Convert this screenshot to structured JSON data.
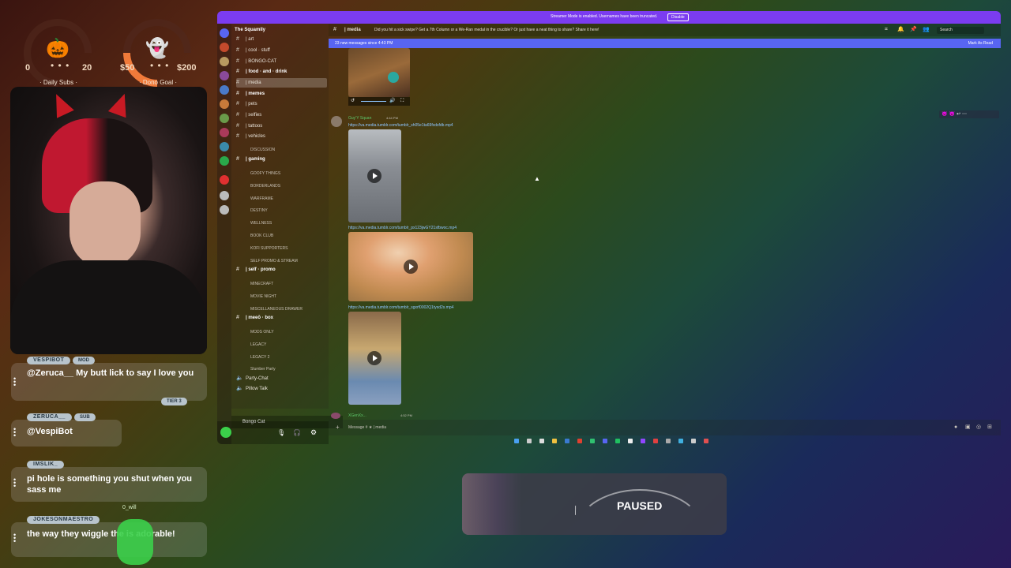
{
  "goals": {
    "subs": {
      "min": "0",
      "dots": "• • •",
      "max": "20",
      "title": "· Daily Subs ·",
      "icon": "🎃",
      "progress": 0.0
    },
    "dono": {
      "min": "$50",
      "dots": "• • •",
      "max": "$200",
      "title": "· Dono Goal ·",
      "icon": "👻",
      "progress": 0.1
    }
  },
  "chat": [
    {
      "user": "VESPIBOT",
      "badge": "MOD",
      "text": "@Zeruca__ My butt lick to say I love you",
      "tier": "TIER 3"
    },
    {
      "user": "ZERUCA__",
      "badge": "SUB",
      "text": "@VespiBot"
    },
    {
      "user": "IMSLIK_",
      "text": "pi hole is something you shut when you sass me"
    },
    {
      "user": "JOKESONMAESTRO",
      "side_name": "0_will",
      "text": "the way they wiggle the         is adorable!"
    }
  ],
  "discord": {
    "banner_text": "Streamer Mode is enabled. Usernames have been truncated.",
    "banner_button": "Disable",
    "server_name": "The Squamily",
    "channel_header": "| media",
    "channel_topic": "Did you hit a sick swipe? Get a 7th Column or a We-Ran medal in the crucible? Or just have a neat thing to share? Share it here!",
    "search_placeholder": "Search",
    "new_messages": "23 new messages since 4:43 PM",
    "mark_as_read": "Mark As Read",
    "channels": [
      {
        "label": "| art",
        "type": "channel"
      },
      {
        "label": "| cool · stuff",
        "type": "channel"
      },
      {
        "label": "| BONGO-CAT",
        "type": "channel"
      },
      {
        "label": "| food · and · drink",
        "type": "channel",
        "bold": true
      },
      {
        "label": "| media",
        "type": "channel",
        "active": true
      },
      {
        "label": "| memes",
        "type": "channel",
        "bold": true
      },
      {
        "label": "| pets",
        "type": "channel"
      },
      {
        "label": "| selfies",
        "type": "channel"
      },
      {
        "label": "| tattoos",
        "type": "channel"
      },
      {
        "label": "| vehicles",
        "type": "channel"
      },
      {
        "label": "DISCUSSION",
        "type": "category"
      },
      {
        "label": "| gaming",
        "type": "channel",
        "bold": true
      },
      {
        "label": "GOOFY THINGS",
        "type": "category"
      },
      {
        "label": "BORDERLANDS",
        "type": "category"
      },
      {
        "label": "WARFRAME",
        "type": "category"
      },
      {
        "label": "DESTINY",
        "type": "category"
      },
      {
        "label": "WELLNESS",
        "type": "category"
      },
      {
        "label": "BOOK CLUB",
        "type": "category"
      },
      {
        "label": "KOFI SUPPORTERS",
        "type": "category"
      },
      {
        "label": "SELF PROMO & STREAM",
        "type": "category"
      },
      {
        "label": "| self · promo",
        "type": "channel",
        "bold": true
      },
      {
        "label": "MINECRAFT",
        "type": "category"
      },
      {
        "label": "MOVIE NIGHT",
        "type": "category"
      },
      {
        "label": "MISCELLANEOUS DRAWER",
        "type": "category"
      },
      {
        "label": "| meeō · box",
        "type": "channel",
        "bold": true
      },
      {
        "label": "MODS ONLY",
        "type": "category"
      },
      {
        "label": "LEGACY",
        "type": "category"
      },
      {
        "label": "LEGACY 2",
        "type": "category"
      },
      {
        "label": "Slumber Party",
        "type": "category"
      },
      {
        "label": "Party-Chat",
        "type": "voice"
      },
      {
        "label": "Pillow Talk",
        "type": "voice"
      }
    ],
    "voice_bar": "Bongo Cat",
    "message_author": "Guy’Y Squan",
    "message_time": "4:44 PM",
    "links": [
      "https://va.media.tumblr.com/tumblr_sh05e1ta69fxdsfdb.mp4",
      "https://va.media.tumblr.com/tumblr_px123jwGY21sfbwoc.mp4",
      "https://va.media.tumblr.com/tumblr_sgxrf0002Q1tysd2s.mp4"
    ],
    "next_author": "XGenXx...",
    "next_time": "4:52 PM",
    "composer_placeholder": "Message # ★ | media"
  },
  "paused": {
    "label": "PAUSED"
  },
  "colors": {
    "accent": "#7b3cf0",
    "blurple": "#5865f2",
    "orange": "#f07a3a"
  }
}
